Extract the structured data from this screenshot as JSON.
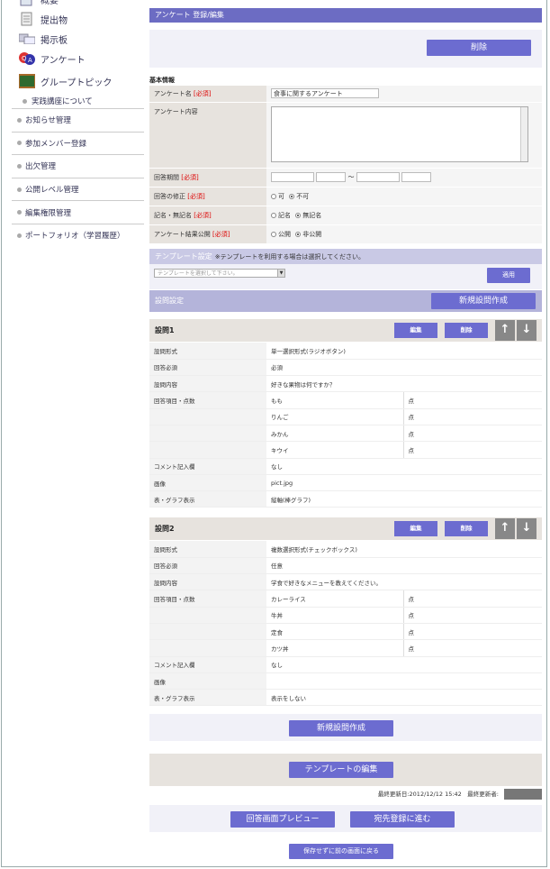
{
  "sidebar": {
    "big_items": [
      {
        "label": "概要",
        "icon": "document-icon"
      },
      {
        "label": "提出物",
        "icon": "submission-icon"
      },
      {
        "label": "掲示板",
        "icon": "board-icon"
      },
      {
        "label": "アンケート",
        "icon": "qa-icon"
      },
      {
        "label": "グループトピック",
        "icon": "chalkboard-icon"
      }
    ],
    "sub_item": "実践講座について",
    "items": [
      "お知らせ管理",
      "参加メンバー登録",
      "出欠管理",
      "公開レベル管理",
      "編集権限管理",
      "ポートフォリオ（学習履歴）"
    ]
  },
  "header": {
    "title": "アンケート 登録/編集",
    "delete_label": "削除"
  },
  "basic": {
    "section_label": "基本情報",
    "name_label": "アンケート名",
    "required": "[必須]",
    "name_value": "食事に関するアンケート",
    "content_label": "アンケート内容",
    "period_label": "回答期間",
    "period_sep": "〜",
    "modify_label": "回答の修正",
    "modify_opts": [
      "可",
      "不可"
    ],
    "named_label": "記名・無記名",
    "named_opts": [
      "記名",
      "無記名"
    ],
    "publish_label": "アンケート結果公開",
    "publish_opts": [
      "公開",
      "非公開"
    ]
  },
  "template": {
    "title": "テンプレート設定",
    "note": "※テンプレートを利用する場合は選択してください。",
    "select_placeholder": "テンプレートを選択して下さい。",
    "apply_label": "適用"
  },
  "questions_bar": {
    "title": "設問設定",
    "new_label": "新規設問作成"
  },
  "labels": {
    "format": "設問形式",
    "required": "回答必須",
    "content": "設問内容",
    "choices": "回答項目・点数",
    "comment": "コメント記入欄",
    "image": "画像",
    "graph": "表・グラフ表示",
    "point": "点",
    "edit": "編集",
    "delete": "削除"
  },
  "questions": [
    {
      "title": "設問1",
      "format": "単一選択形式(ラジオボタン)",
      "required": "必須",
      "content": "好きな果物は何ですか？",
      "choices": [
        "もも",
        "りんご",
        "みかん",
        "キウイ"
      ],
      "comment": "なし",
      "image": "pict.jpg",
      "graph": "縦軸(棒グラフ)"
    },
    {
      "title": "設問2",
      "format": "複数選択形式(チェックボックス)",
      "required": "任意",
      "content": "学食で好きなメニューを教えてください。",
      "choices": [
        "カレーライス",
        "牛丼",
        "定食",
        "カツ丼"
      ],
      "comment": "なし",
      "image": "",
      "graph": "表示をしない"
    }
  ],
  "bottom": {
    "new_label": "新規設問作成",
    "template_edit_label": "テンプレートの編集",
    "meta": "最終更新日:2012/12/12 15:42　最終更新者:",
    "preview_label": "回答画面プレビュー",
    "next_label": "宛先登録に進む",
    "back_label": "保存せずに前の画面に戻る"
  }
}
